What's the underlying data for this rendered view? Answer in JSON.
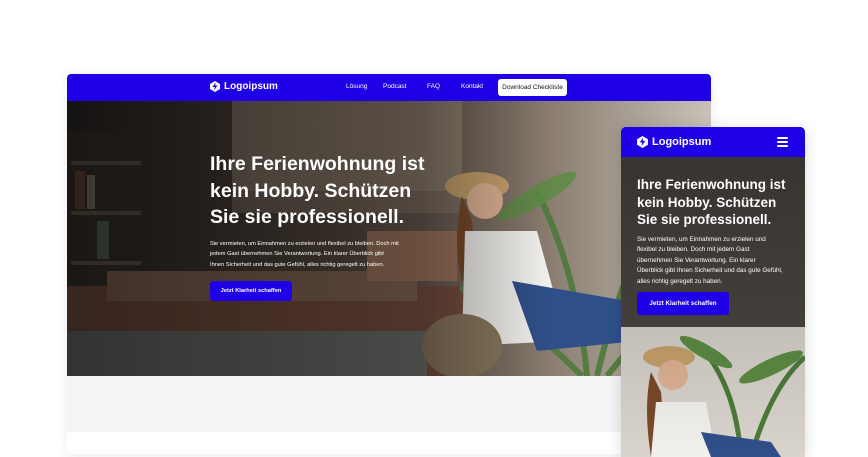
{
  "brand": {
    "logo_text": "Logoipsum",
    "primary_color": "#1f00e6"
  },
  "nav": {
    "links": [
      "Lösung",
      "Podcast",
      "FAQ",
      "Kontakt"
    ],
    "cta_label": "Download Checkliste"
  },
  "hero": {
    "headline_lines": [
      "Ihre Ferienwohnung ist",
      "kein Hobby. Schützen",
      "Sie sie professionell."
    ],
    "desktop_paragraph_lines": [
      "Sie vermieten, um Einnahmen zu erzielen und flexibel zu bleiben. Doch mit",
      "jedem Gast übernehmen Sie Verantwortung. Ein klarer Überblick gibt",
      "Ihnen Sicherheit und das gute Gefühl, alles richtig geregelt zu haben."
    ],
    "mobile_paragraph_lines": [
      "Sie vermieten, um Einnahmen zu erzielen und",
      "flexibel zu bleiben. Doch mit jedem Gast",
      "übernehmen Sie Verantwortung. Ein klarer",
      "Überblick gibt Ihnen Sicherheit und das gute Gefühl,",
      "alles richtig geregelt zu haben."
    ],
    "button_label": "Jetzt Klarheit schaffen"
  },
  "icons": {
    "logo": "logo-mark-icon",
    "menu": "hamburger-menu-icon"
  }
}
